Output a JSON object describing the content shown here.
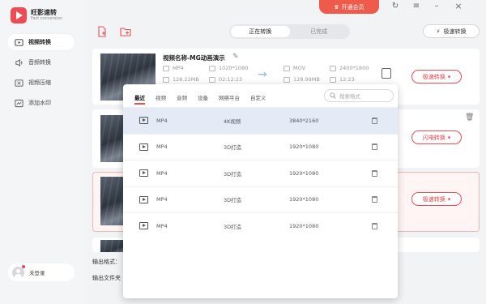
{
  "app": {
    "title": "旺影速转",
    "subtitle": "Fast conversion"
  },
  "sidebar": {
    "items": [
      {
        "label": "视频转换",
        "icon": "video-convert-icon",
        "active": true
      },
      {
        "label": "音频转换",
        "icon": "audio-convert-icon",
        "active": false
      },
      {
        "label": "视频压缩",
        "icon": "video-compress-icon",
        "active": false
      },
      {
        "label": "添加水印",
        "icon": "watermark-icon",
        "active": false
      }
    ]
  },
  "user": {
    "label": "未登录"
  },
  "header": {
    "vip_label": "开通会员",
    "tabs": [
      {
        "label": "正在转换",
        "active": true
      },
      {
        "label": "已完成",
        "active": false
      }
    ],
    "turbo_label": "极速转换"
  },
  "file": {
    "name": "视频名称-MG动画演示",
    "src_format": "MP4",
    "src_resolution": "1020*1080",
    "src_size": "128.22MB",
    "src_duration": "02:12:23",
    "dst_format": "MOV",
    "dst_resolution": "2400*1800",
    "dst_size": "128.99MB",
    "dst_duration": "12:23"
  },
  "cards": [
    {
      "action": "极速转换"
    },
    {
      "action": "闪电转换"
    },
    {
      "action": "极速转换"
    }
  ],
  "bottom": {
    "output_format_label": "输出格式：",
    "output_folder_label": "输出文件夹"
  },
  "popup": {
    "tabs": [
      "最近",
      "视频",
      "音频",
      "设备",
      "网络平台",
      "自定义"
    ],
    "active_tab": "最近",
    "search_placeholder": "搜索格式",
    "rows": [
      {
        "format": "MP4",
        "quality": "4K视频",
        "resolution": "3840*2160"
      },
      {
        "format": "MP4",
        "quality": "3D打造",
        "resolution": "1920*1080"
      },
      {
        "format": "MP4",
        "quality": "3D打造",
        "resolution": "1920*1080"
      },
      {
        "format": "MP4",
        "quality": "3D打造",
        "resolution": "1920*1080"
      },
      {
        "format": "MP4",
        "quality": "3D打造",
        "resolution": "1920*1080"
      }
    ]
  },
  "colors": {
    "accent": "#ef4b52",
    "vip": "#ef5b4a",
    "selected_row": "#e4ebf6",
    "arrow": "#8fb5e8"
  }
}
